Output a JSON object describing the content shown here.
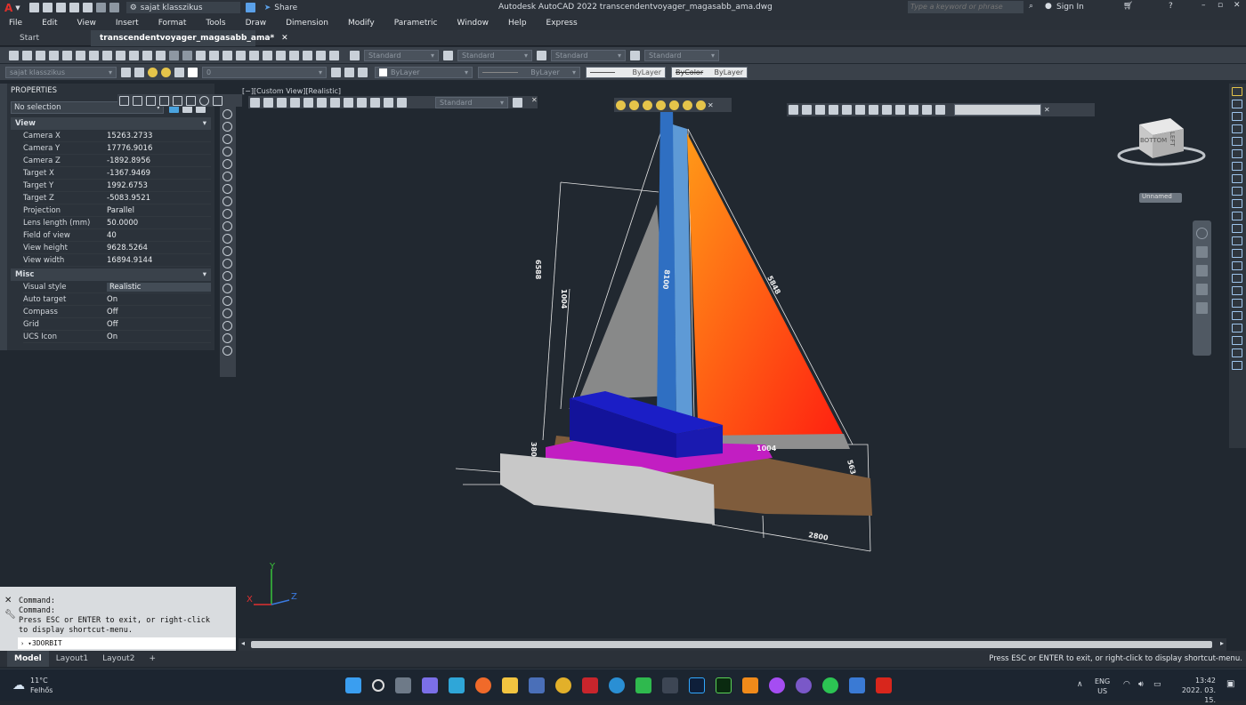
{
  "titlebar": {
    "app_logo": "A",
    "workspace": "sajat klasszikus",
    "share_label": "Share",
    "title": "Autodesk AutoCAD 2022   transcendentvoyager_magasabb_ama.dwg",
    "search_placeholder": "Type a keyword or phrase",
    "signin_label": "Sign In"
  },
  "menu": [
    "File",
    "Edit",
    "View",
    "Insert",
    "Format",
    "Tools",
    "Draw",
    "Dimension",
    "Modify",
    "Parametric",
    "Window",
    "Help",
    "Express"
  ],
  "tabs": {
    "start": "Start",
    "file": "transcendentvoyager_magasabb_ama*",
    "add": "+"
  },
  "toolbar": {
    "text_style": "Standard",
    "dim_style": "Standard",
    "table_style": "Standard",
    "mleader_style": "Standard",
    "workspace_combo": "sajat klasszikus",
    "layer": "0",
    "color": "ByLayer",
    "linetype": "ByLayer",
    "lineweight": "ByLayer",
    "plotstyle": "ByColor",
    "plotstyle_ghost": "ByLayer",
    "viewport_style": "Standard"
  },
  "properties": {
    "header": "PROPERTIES",
    "selection": "No selection",
    "view_cat": "View",
    "view_rows": [
      {
        "k": "Camera X",
        "v": "15263.2733"
      },
      {
        "k": "Camera Y",
        "v": "17776.9016"
      },
      {
        "k": "Camera Z",
        "v": "-1892.8956"
      },
      {
        "k": "Target X",
        "v": "-1367.9469"
      },
      {
        "k": "Target Y",
        "v": "1992.6753"
      },
      {
        "k": "Target Z",
        "v": "-5083.9521"
      },
      {
        "k": "Projection",
        "v": "Parallel"
      },
      {
        "k": "Lens length (mm)",
        "v": "50.0000"
      },
      {
        "k": "Field of view",
        "v": "40"
      },
      {
        "k": "View height",
        "v": "9628.5264"
      },
      {
        "k": "View width",
        "v": "16894.9144"
      }
    ],
    "misc_cat": "Misc",
    "misc_rows": [
      {
        "k": "Visual style",
        "v": "Realistic"
      },
      {
        "k": "Auto target",
        "v": "On"
      },
      {
        "k": "Compass",
        "v": "Off"
      },
      {
        "k": "Grid",
        "v": "Off"
      },
      {
        "k": "UCS Icon",
        "v": "On"
      }
    ]
  },
  "viewport": {
    "label": "[−][Custom View][Realistic]",
    "viewcube_top": "BOTTOM",
    "viewcube_side": "LEFT",
    "ucs_combo": "Unnamed",
    "dims": {
      "d1": "6588",
      "d2": "1004",
      "d3": "8100",
      "d4": "5848",
      "d5": "380",
      "d6": "1004",
      "d7": "563",
      "d8": "2800"
    },
    "axis_x": "X",
    "axis_y": "Y",
    "axis_z": "Z"
  },
  "command": {
    "lines": [
      "Command:",
      "Command:",
      "Press ESC or ENTER to exit, or right-click",
      "to display shortcut-menu."
    ],
    "input": "3DORBIT"
  },
  "layouts": [
    "Model",
    "Layout1",
    "Layout2",
    "+"
  ],
  "status_text": "Press ESC or ENTER to exit, or right-click to display shortcut-menu.",
  "taskbar": {
    "temp": "11°C",
    "weather": "Felhős",
    "lang1": "ENG",
    "lang2": "US",
    "time": "13:42",
    "date": "2022. 03. 15."
  },
  "colors": {
    "jib": "#8f8f8f",
    "main_sail": "#ff5a14",
    "mast": "#2f6fc2",
    "cabin": "#1a1aa8",
    "deck": "#c21ec2",
    "hull_left": "#c8c8c8",
    "hull_right": "#7f5c3c"
  }
}
